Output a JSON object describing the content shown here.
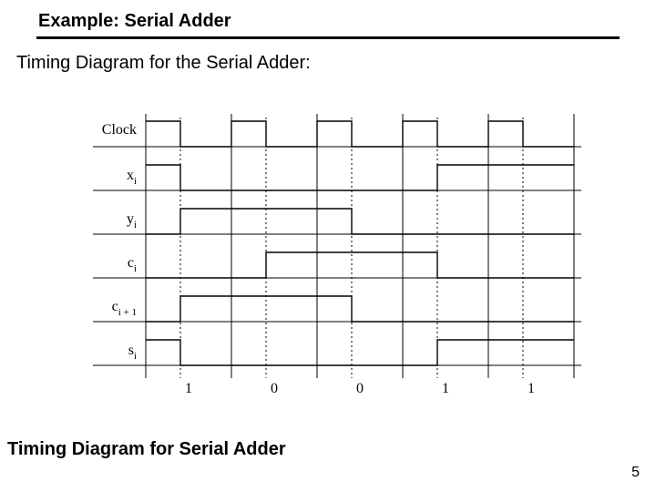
{
  "title": "Example: Serial Adder",
  "subtitle": "Timing Diagram for the Serial Adder:",
  "caption": "Timing Diagram for Serial Adder",
  "page_number": "5",
  "diagram": {
    "row_labels": [
      "Clock",
      "x",
      "y",
      "c",
      "c",
      "s"
    ],
    "row_label_subs": [
      "",
      "i",
      "i",
      "i",
      "i + 1",
      "i"
    ],
    "bottom_values": [
      "1",
      "0",
      "0",
      "1",
      "1"
    ]
  },
  "chart_data": {
    "type": "timing",
    "cycles": 5,
    "x_ticks": [
      0,
      100,
      200,
      300,
      400,
      500
    ],
    "signals": [
      {
        "name": "Clock",
        "type": "clock",
        "period": 100,
        "duty": 0.4,
        "levels": [
          1,
          0,
          1,
          0,
          1,
          0,
          1,
          0,
          1,
          0
        ]
      },
      {
        "name": "x_i",
        "levels_per_cycle": [
          1,
          0,
          0,
          1,
          1
        ]
      },
      {
        "name": "y_i",
        "levels_per_cycle": [
          0,
          1,
          1,
          0,
          0
        ]
      },
      {
        "name": "c_i",
        "levels_per_cycle": [
          0,
          0,
          1,
          1,
          0
        ]
      },
      {
        "name": "c_{i+1}",
        "levels_per_cycle": [
          0,
          1,
          1,
          0,
          0
        ]
      },
      {
        "name": "s_i",
        "levels_per_cycle": [
          1,
          0,
          0,
          1,
          1
        ]
      }
    ],
    "bottom_annotation": [
      "1",
      "0",
      "0",
      "1",
      "1"
    ]
  }
}
